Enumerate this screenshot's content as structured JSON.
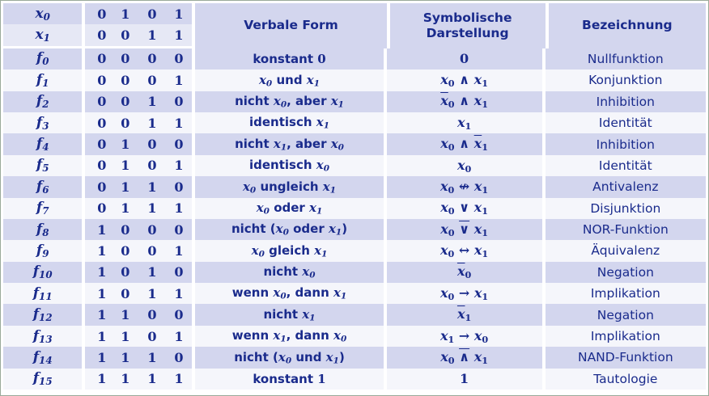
{
  "header": {
    "input_rows": [
      {
        "var": "x",
        "sub": "0",
        "bits": [
          "0",
          "1",
          "0",
          "1"
        ]
      },
      {
        "var": "x",
        "sub": "1",
        "bits": [
          "0",
          "0",
          "1",
          "1"
        ]
      }
    ],
    "col_verbal": "Verbale Form",
    "col_symbolic_1": "Symbolische",
    "col_symbolic_2": "Darstellung",
    "col_name": "Bezeichnung"
  },
  "rows": [
    {
      "f": "f",
      "sub": "0",
      "bits": [
        "0",
        "0",
        "0",
        "0"
      ],
      "verbal_html": "konstant <span class='it' style='font-style:normal'>0</span>",
      "symbolic_html": "0",
      "name": "Nullfunktion"
    },
    {
      "f": "f",
      "sub": "1",
      "bits": [
        "0",
        "0",
        "0",
        "1"
      ],
      "verbal_html": "<span class='it'>x</span><sub class='it'>0</sub> und <span class='it'>x</span><sub class='it'>1</sub>",
      "symbolic_html": "<span class='it'>x</span><sub>0</sub> ∧ <span class='it'>x</span><sub>1</sub>",
      "name": "Konjunktion"
    },
    {
      "f": "f",
      "sub": "2",
      "bits": [
        "0",
        "0",
        "1",
        "0"
      ],
      "verbal_html": "nicht <span class='it'>x</span><sub class='it'>0</sub>, aber <span class='it'>x</span><sub class='it'>1</sub>",
      "symbolic_html": "<span class='bar'><span class='it'>x</span></span><sub>0</sub> ∧ <span class='it'>x</span><sub>1</sub>",
      "name": "Inhibition"
    },
    {
      "f": "f",
      "sub": "3",
      "bits": [
        "0",
        "0",
        "1",
        "1"
      ],
      "verbal_html": "identisch <span class='it'>x</span><sub class='it'>1</sub>",
      "symbolic_html": "<span class='it'>x</span><sub>1</sub>",
      "name": "Identität"
    },
    {
      "f": "f",
      "sub": "4",
      "bits": [
        "0",
        "1",
        "0",
        "0"
      ],
      "verbal_html": "nicht <span class='it'>x</span><sub class='it'>1</sub>, aber <span class='it'>x</span><sub class='it'>0</sub>",
      "symbolic_html": "<span class='it'>x</span><sub>0</sub> ∧ <span class='bar'><span class='it'>x</span></span><sub>1</sub>",
      "name": "Inhibition"
    },
    {
      "f": "f",
      "sub": "5",
      "bits": [
        "0",
        "1",
        "0",
        "1"
      ],
      "verbal_html": "identisch <span class='it'>x</span><sub class='it'>0</sub>",
      "symbolic_html": "<span class='it'>x</span><sub>0</sub>",
      "name": "Identität"
    },
    {
      "f": "f",
      "sub": "6",
      "bits": [
        "0",
        "1",
        "1",
        "0"
      ],
      "verbal_html": "<span class='it'>x</span><sub class='it'>0</sub> ungleich <span class='it'>x</span><sub class='it'>1</sub>",
      "symbolic_html": "<span class='it'>x</span><sub>0</sub> ↮ <span class='it'>x</span><sub>1</sub>",
      "name": "Antivalenz"
    },
    {
      "f": "f",
      "sub": "7",
      "bits": [
        "0",
        "1",
        "1",
        "1"
      ],
      "verbal_html": "<span class='it'>x</span><sub class='it'>0</sub> oder <span class='it'>x</span><sub class='it'>1</sub>",
      "symbolic_html": "<span class='it'>x</span><sub>0</sub> ∨ <span class='it'>x</span><sub>1</sub>",
      "name": "Disjunktion"
    },
    {
      "f": "f",
      "sub": "8",
      "bits": [
        "1",
        "0",
        "0",
        "0"
      ],
      "verbal_html": "nicht (<span class='it'>x</span><sub class='it'>0</sub> oder <span class='it'>x</span><sub class='it'>1</sub>)",
      "symbolic_html": "<span class='it'>x</span><sub>0</sub> <span class='bar'>∨</span> <span class='it'>x</span><sub>1</sub>",
      "name": "NOR-Funktion"
    },
    {
      "f": "f",
      "sub": "9",
      "bits": [
        "1",
        "0",
        "0",
        "1"
      ],
      "verbal_html": "<span class='it'>x</span><sub class='it'>0</sub> gleich <span class='it'>x</span><sub class='it'>1</sub>",
      "symbolic_html": "<span class='it'>x</span><sub>0</sub> ↔ <span class='it'>x</span><sub>1</sub>",
      "name": "Äquivalenz"
    },
    {
      "f": "f",
      "sub": "10",
      "bits": [
        "1",
        "0",
        "1",
        "0"
      ],
      "verbal_html": "nicht <span class='it'>x</span><sub class='it'>0</sub>",
      "symbolic_html": "<span class='bar'><span class='it'>x</span></span><sub>0</sub>",
      "name": "Negation"
    },
    {
      "f": "f",
      "sub": "11",
      "bits": [
        "1",
        "0",
        "1",
        "1"
      ],
      "verbal_html": "wenn <span class='it'>x</span><sub class='it'>0</sub>, dann <span class='it'>x</span><sub class='it'>1</sub>",
      "symbolic_html": "<span class='it'>x</span><sub>0</sub> → <span class='it'>x</span><sub>1</sub>",
      "name": "Implikation"
    },
    {
      "f": "f",
      "sub": "12",
      "bits": [
        "1",
        "1",
        "0",
        "0"
      ],
      "verbal_html": "nicht <span class='it'>x</span><sub class='it'>1</sub>",
      "symbolic_html": "<span class='bar'><span class='it'>x</span></span><sub>1</sub>",
      "name": "Negation"
    },
    {
      "f": "f",
      "sub": "13",
      "bits": [
        "1",
        "1",
        "0",
        "1"
      ],
      "verbal_html": "wenn <span class='it'>x</span><sub class='it'>1</sub>, dann <span class='it'>x</span><sub class='it'>0</sub>",
      "symbolic_html": "<span class='it'>x</span><sub>1</sub> → <span class='it'>x</span><sub>0</sub>",
      "name": "Implikation"
    },
    {
      "f": "f",
      "sub": "14",
      "bits": [
        "1",
        "1",
        "1",
        "0"
      ],
      "verbal_html": "nicht (<span class='it'>x</span><sub class='it'>0</sub> und <span class='it'>x</span><sub class='it'>1</sub>)",
      "symbolic_html": "<span class='it'>x</span><sub>0</sub> <span class='bar'>∧</span> <span class='it'>x</span><sub>1</sub>",
      "name": "NAND-Funktion"
    },
    {
      "f": "f",
      "sub": "15",
      "bits": [
        "1",
        "1",
        "1",
        "1"
      ],
      "verbal_html": "konstant <span class='it' style='font-style:normal'>1</span>",
      "symbolic_html": "1",
      "name": "Tautologie"
    }
  ]
}
